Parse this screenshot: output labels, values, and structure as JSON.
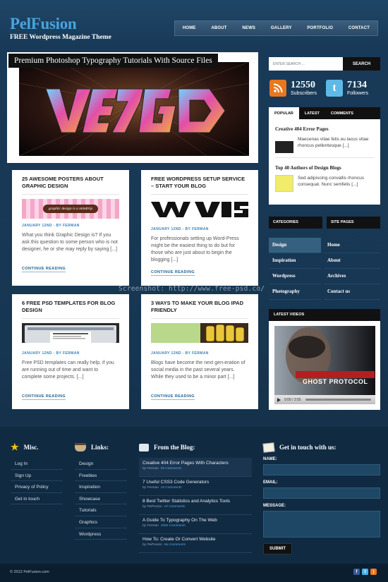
{
  "header": {
    "logo_title": "PelFusion",
    "tagline": "FREE Wordpress Magazine Theme",
    "nav": [
      "HOME",
      "ABOUT",
      "NEWS",
      "GALLERY",
      "PORTFOLIO",
      "CONTACT"
    ]
  },
  "featured": {
    "title": "Premium Photoshop Typography Tutorials With Source Files"
  },
  "posts": [
    {
      "title": "25 AWESOME POSTERS ABOUT GRAPHIC DESIGN",
      "image_text": "graphic design is a mindtrip",
      "meta": "JANUARY 12ND - BY FERMAN",
      "excerpt": "What you think Graphic Design is? If you ask this question to some person who is not designer, he or she may reply by saying [...]",
      "more": "CONTINUE READING"
    },
    {
      "title": "FREE WORDPRESS SETUP SERVICE – START YOUR BLOG",
      "meta": "JANUARY 12ND - BY FERMAN",
      "excerpt": "For professionals setting up Word-Press might be the easiest thing to do but for those who are just about to begin the blogging [...]",
      "more": "CONTINUE READING"
    },
    {
      "title": "6 FREE PSD TEMPLATES FOR BLOG DESIGN",
      "meta": "JANUARY 12ND - BY FERMAN",
      "excerpt": "Free PSD templates can really help, if you are running out of time and want to complete some projects. [...]",
      "more": "CONTINUE READING"
    },
    {
      "title": "3 WAYS TO MAKE YOUR BLOG IPAD FRIENDLY",
      "meta": "JANUARY 12ND - BY FERMAN",
      "excerpt": "Blogs have become the next gen-eration of social media in the past several years. While they used to be a minor part [...]",
      "more": "CONTINUE READING"
    }
  ],
  "sidebar": {
    "search_placeholder": "ENTER SEARCH ...",
    "search_button": "SEARCH",
    "subscribers_count": "12550",
    "subscribers_label": "Subscribers",
    "followers_count": "7134",
    "followers_label": "Followers",
    "tabs": [
      "POPULAR",
      "LATEST",
      "COMMENTS"
    ],
    "popular": [
      {
        "title": "Creative 404 Error Pages",
        "text": "Maecenas vitae felis eu lacus vitae rhoncus pellentesque [...]"
      },
      {
        "title": "Top 40 Authors of Design Blogs",
        "text": "Sed adipiscing convallis rhoncus consequat. Nunc semfelis [...]"
      }
    ],
    "categories_head": "CATEGORIES",
    "categories": [
      "Design",
      "Inspiration",
      "Wordpress",
      "Photography"
    ],
    "site_pages_head": "SITE PAGES",
    "site_pages": [
      "Home",
      "About",
      "Archives",
      "Contact us"
    ],
    "latest_videos_head": "LATEST VIDEOS",
    "video_title": "GHOST PROTOCOL",
    "video_time": "0:00 / 3:55"
  },
  "watermark": "Screenshot: http://www.free-psd.co/",
  "footer": {
    "misc_head": "Misc.",
    "misc": [
      "Log In",
      "Sign Up",
      "Privacy of Policy",
      "Get in touch"
    ],
    "links_head": "Links:",
    "links": [
      "Design",
      "Freebies",
      "Inspiration",
      "Showcase",
      "Tutorials",
      "Graphics",
      "Wordpress"
    ],
    "blog_head": "From the Blog:",
    "blog": [
      {
        "title": "Creative 404 Error Pages With Characters",
        "author": "Ferman",
        "comments": "55 Comments"
      },
      {
        "title": "7 Useful CSS3 Code Generators",
        "author": "Ferman",
        "comments": "15 Comments"
      },
      {
        "title": "8 Best Twitter Statistics and Analytics Tools",
        "author": "PelFusion",
        "comments": "15 Comments"
      },
      {
        "title": "A Guide To Typography On The Web",
        "author": "Ferman",
        "comments": "1002 Comments"
      },
      {
        "title": "How To: Create Or Convert Website",
        "author": "PelFusion",
        "comments": "No Comments"
      }
    ],
    "by_label": "by",
    "contact_head": "Get in touch with us:",
    "name_label": "NAME:",
    "email_label": "EMAIL:",
    "message_label": "MESSAGE:",
    "submit": "SUBMIT",
    "copyright": "© 2012 PelFusion.com"
  }
}
